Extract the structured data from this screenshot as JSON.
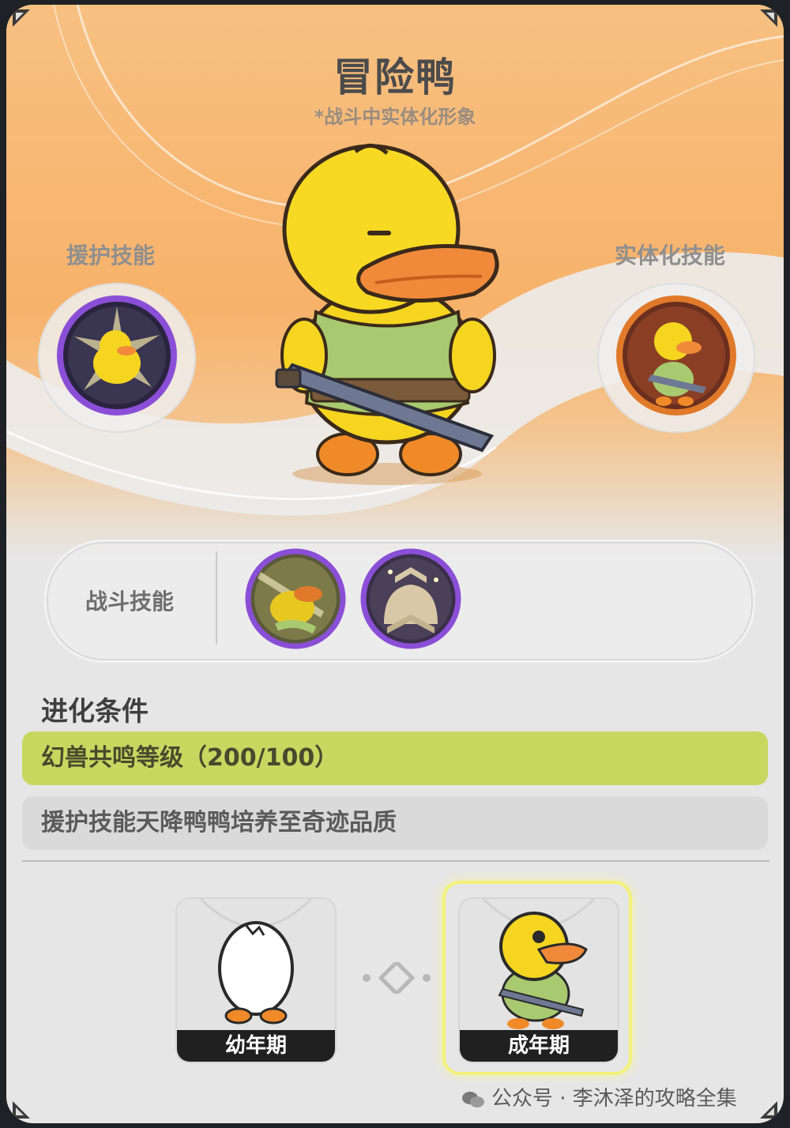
{
  "pet": {
    "name": "冒险鸭",
    "subtitle": "*战斗中实体化形象"
  },
  "skills": {
    "support_label": "援护技能",
    "materialize_label": "实体化技能",
    "combat_label": "战斗技能"
  },
  "evolution": {
    "title": "进化条件",
    "conditions": [
      {
        "text": "幻兽共鸣等级（200/100）",
        "met": true
      },
      {
        "text": "援护技能天降鸭鸭培养至奇迹品质",
        "met": false
      }
    ],
    "stages": [
      {
        "label": "幼年期",
        "selected": false
      },
      {
        "label": "成年期",
        "selected": true
      }
    ]
  },
  "watermark": "公众号 · 李沐泽的攻略全集",
  "colors": {
    "hero_orange": "#f7b26a",
    "condition_met": "#c6d860",
    "condition_unmet": "#dadada",
    "epic_ring": "#8a4fd6",
    "legend_ring": "#e07a2a",
    "selected_glow": "#f2f27a"
  }
}
